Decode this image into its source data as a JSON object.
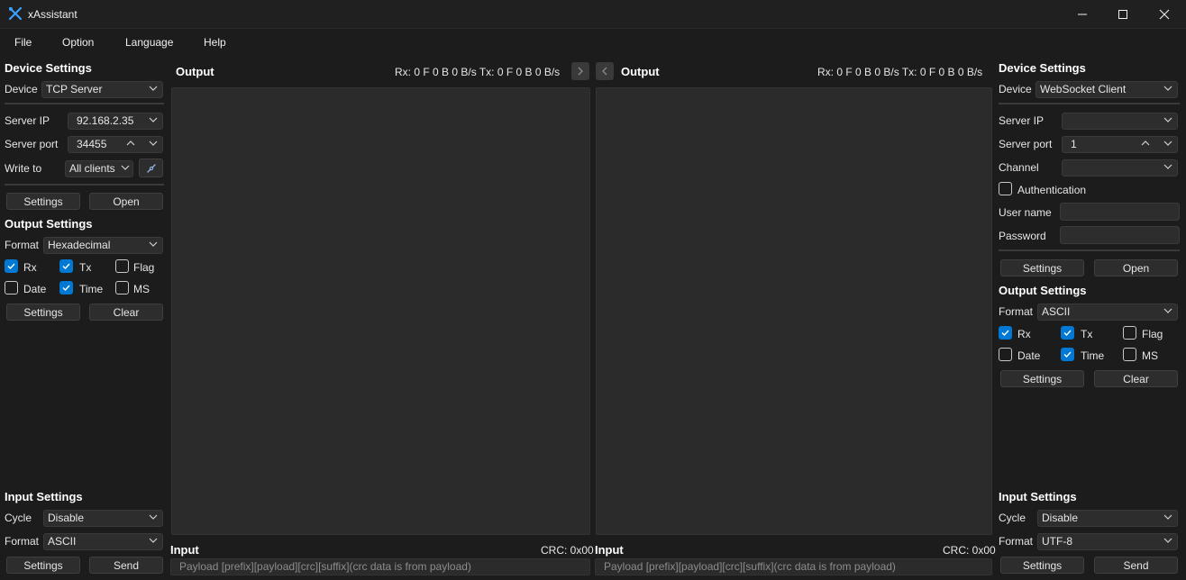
{
  "window": {
    "title": "xAssistant"
  },
  "menu": [
    "File",
    "Option",
    "Language",
    "Help"
  ],
  "left": {
    "device_settings": {
      "title": "Device Settings",
      "device_label": "Device",
      "device_value": "TCP Server",
      "server_ip_label": "Server IP",
      "server_ip_value": "92.168.2.35",
      "server_port_label": "Server port",
      "server_port_value": "34455",
      "write_to_label": "Write to",
      "write_to_value": "All clients",
      "settings_btn": "Settings",
      "open_btn": "Open"
    },
    "output_settings": {
      "title": "Output Settings",
      "format_label": "Format",
      "format_value": "Hexadecimal",
      "checks": [
        {
          "label": "Rx",
          "checked": true
        },
        {
          "label": "Tx",
          "checked": true
        },
        {
          "label": "Flag",
          "checked": false
        },
        {
          "label": "Date",
          "checked": false
        },
        {
          "label": "Time",
          "checked": true
        },
        {
          "label": "MS",
          "checked": false
        }
      ],
      "settings_btn": "Settings",
      "clear_btn": "Clear"
    },
    "input_settings": {
      "title": "Input Settings",
      "cycle_label": "Cycle",
      "cycle_value": "Disable",
      "format_label": "Format",
      "format_value": "ASCII",
      "settings_btn": "Settings",
      "send_btn": "Send"
    }
  },
  "center_left": {
    "output_title": "Output",
    "stats": "Rx: 0 F 0 B 0 B/s Tx: 0 F 0 B 0 B/s",
    "input_title": "Input",
    "crc": "CRC: 0x00",
    "input_placeholder": "Payload [prefix][payload][crc][suffix](crc data is from payload)"
  },
  "center_right": {
    "output_title": "Output",
    "stats": "Rx: 0 F 0 B 0 B/s Tx: 0 F 0 B 0 B/s",
    "input_title": "Input",
    "crc": "CRC: 0x00",
    "input_placeholder": "Payload [prefix][payload][crc][suffix](crc data is from payload)"
  },
  "right": {
    "device_settings": {
      "title": "Device Settings",
      "device_label": "Device",
      "device_value": "WebSocket Client",
      "server_ip_label": "Server IP",
      "server_ip_value": "",
      "server_port_label": "Server port",
      "server_port_value": "1",
      "channel_label": "Channel",
      "channel_value": "",
      "auth_label": "Authentication",
      "auth_checked": false,
      "username_label": "User name",
      "password_label": "Password",
      "settings_btn": "Settings",
      "open_btn": "Open"
    },
    "output_settings": {
      "title": "Output Settings",
      "format_label": "Format",
      "format_value": "ASCII",
      "checks": [
        {
          "label": "Rx",
          "checked": true
        },
        {
          "label": "Tx",
          "checked": true
        },
        {
          "label": "Flag",
          "checked": false
        },
        {
          "label": "Date",
          "checked": false
        },
        {
          "label": "Time",
          "checked": true
        },
        {
          "label": "MS",
          "checked": false
        }
      ],
      "settings_btn": "Settings",
      "clear_btn": "Clear"
    },
    "input_settings": {
      "title": "Input Settings",
      "cycle_label": "Cycle",
      "cycle_value": "Disable",
      "format_label": "Format",
      "format_value": "UTF-8",
      "settings_btn": "Settings",
      "send_btn": "Send"
    }
  },
  "colors": {
    "accent": "#0078d4",
    "background": "#1c1c1c",
    "panel": "#2b2b2b"
  }
}
